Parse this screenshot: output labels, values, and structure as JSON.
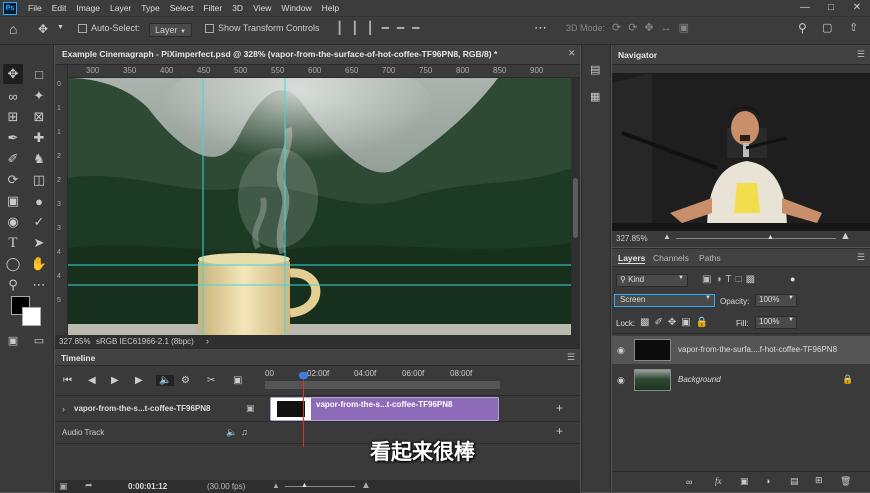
{
  "menubar": {
    "logo": "Ps",
    "items": [
      "File",
      "Edit",
      "Image",
      "Layer",
      "Type",
      "Select",
      "Filter",
      "3D",
      "View",
      "Window",
      "Help"
    ]
  },
  "options": {
    "auto_select_label": "Auto-Select:",
    "layer_dropdown": "Layer",
    "transform_label": "Show Transform Controls",
    "mode_3d": "3D Mode:"
  },
  "document": {
    "tab_title": "Example Cinemagraph - PiXimperfect.psd @ 328% (vapor-from-the-surface-of-hot-coffee-TF96PN8, RGB/8) *",
    "ruler_top": [
      "300",
      "350",
      "400",
      "450",
      "500",
      "550",
      "600",
      "650",
      "700",
      "750",
      "800",
      "850",
      "900"
    ],
    "ruler_left": [
      "0",
      "1",
      "1",
      "2",
      "2",
      "3",
      "3",
      "4",
      "4",
      "5"
    ],
    "zoom": "327.85%",
    "profile": "sRGB IEC61966-2.1 (8bpc)"
  },
  "timeline": {
    "title": "Timeline",
    "time_marks": [
      "00",
      "02:00f",
      "04:00f",
      "06:00f",
      "08:00f"
    ],
    "track_video_label": "vapor-from-the-s...t-coffee-TF96PN8",
    "clip_label": "vapor-from-the-s...t-coffee-TF96PN8",
    "track_audio_label": "Audio Track",
    "current_time": "0:00:01:12",
    "fps": "(30.00 fps)"
  },
  "subtitle": "看起来很棒",
  "navigator": {
    "title": "Navigator",
    "zoom": "327.85%"
  },
  "layers_panel": {
    "tabs": [
      "Layers",
      "Channels",
      "Paths"
    ],
    "filter": "Kind",
    "blend_mode": "Screen",
    "opacity_label": "Opacity:",
    "opacity": "100%",
    "lock_label": "Lock:",
    "fill_label": "Fill:",
    "fill": "100%",
    "layers": [
      {
        "name": "vapor-from-the-surfa....f-hot-coffee-TF96PN8"
      },
      {
        "name": "Background"
      }
    ]
  },
  "colors": {
    "accent": "#31a8ff",
    "clip": "#8d6bb8",
    "playhead": "#e03030"
  }
}
